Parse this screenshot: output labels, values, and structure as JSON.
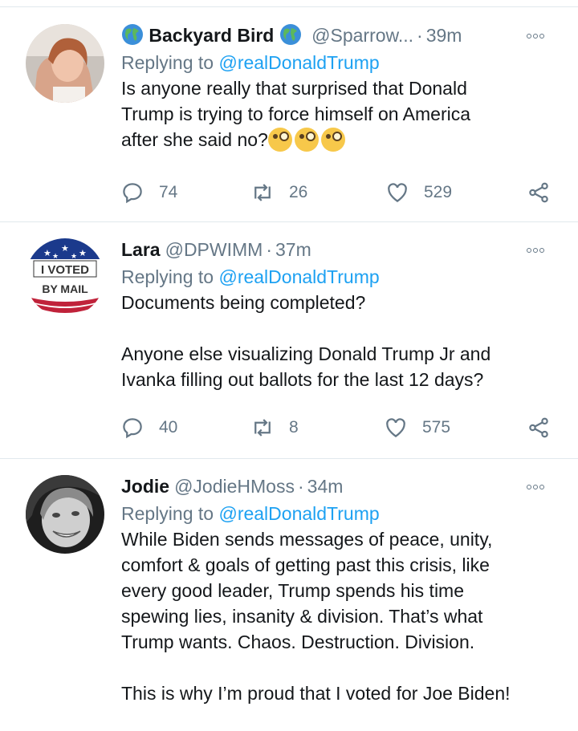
{
  "tweets": [
    {
      "name": "Backyard Bird",
      "name_prefix_icon": "globe-emoji",
      "name_suffix_icon": "globe-emoji",
      "handle": "@Sparrow...",
      "time": "39m",
      "replying_prefix": "Replying to ",
      "replying_to": "@realDonaldTrump",
      "text": "Is anyone really that surprised that Donald\nTrump is trying to force himself on America\nafter she said no?",
      "text_emojis": [
        "face-with-monocle",
        "face-with-monocle",
        "face-with-monocle"
      ],
      "replies": "74",
      "retweets": "26",
      "likes": "529"
    },
    {
      "name": "Lara",
      "handle": "@DPWIMM",
      "time": "37m",
      "replying_prefix": "Replying to ",
      "replying_to": "@realDonaldTrump",
      "text": "Documents being completed?\n\nAnyone else visualizing Donald Trump Jr and\nIvanka filling out ballots for the last 12 days?",
      "avatar_text_1": "I VOTED",
      "avatar_text_2": "BY MAIL",
      "replies": "40",
      "retweets": "8",
      "likes": "575"
    },
    {
      "name": "Jodie",
      "handle": "@JodieHMoss",
      "time": "34m",
      "replying_prefix": "Replying to ",
      "replying_to": "@realDonaldTrump",
      "text": "While Biden sends messages of peace, unity,\ncomfort & goals of getting past this crisis, like\nevery good leader, Trump spends his time\nspewing lies, insanity & division. That’s what\nTrump wants. Chaos. Destruction. Division.\n\nThis is why I’m proud that I voted for Joe Biden!"
    }
  ],
  "colors": {
    "link": "#1da1f2",
    "secondary_text": "#657786",
    "divider": "#e1e8ed"
  }
}
